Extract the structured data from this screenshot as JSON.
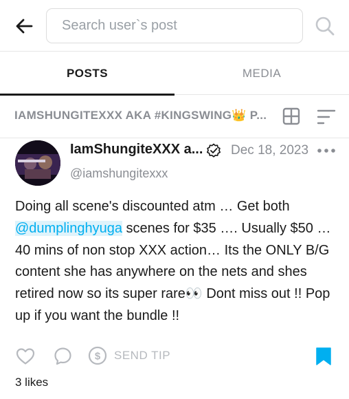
{
  "header": {
    "back_icon": "arrow-left-icon",
    "search": {
      "placeholder": "Search user`s post",
      "value": ""
    },
    "search_icon": "search-icon"
  },
  "tabs": [
    {
      "label": "POSTS",
      "active": true
    },
    {
      "label": "MEDIA",
      "active": false
    }
  ],
  "feed_bar": {
    "title": "IAMSHUNGITEXXX AKA #KINGSWING👑 P...",
    "grid_icon": "grid-view-icon",
    "sort_icon": "sort-icon"
  },
  "post": {
    "author_name": "IamShungiteXXX a...",
    "verified_icon": "verified-badge-icon",
    "date": "Dec 18, 2023",
    "handle": "@iamshungitexxx",
    "text_part1": "Doing all scene's discounted atm … Get both ",
    "mention": "@dumplinghyuga",
    "text_part2": " scenes for $35 …. Usually $50 … 40 mins of non stop XXX action… Its the ONLY B/G content she has anywhere on the nets and shes retired now so its super rare👀 Dont miss out !! Pop up if you want the bundle !!",
    "actions": {
      "like_icon": "heart-icon",
      "comment_icon": "comment-icon",
      "tip_icon": "dollar-coin-icon",
      "tip_label": "SEND TIP",
      "bookmark_icon": "bookmark-icon"
    },
    "likes": "3 likes"
  },
  "colors": {
    "accent": "#00aff0",
    "muted": "#8a8d93",
    "text": "#1a1a1a",
    "divider": "#e6e6e6"
  }
}
